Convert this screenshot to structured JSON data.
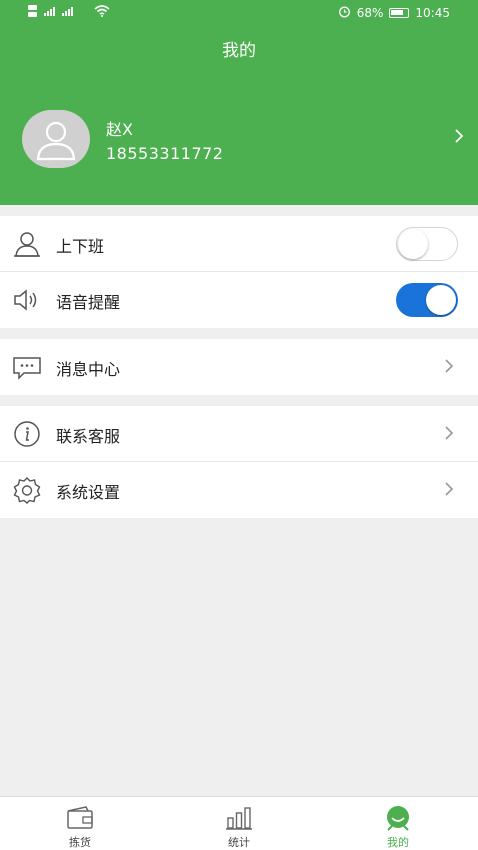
{
  "status_bar": {
    "battery": "68%",
    "time": "10:45"
  },
  "header": {
    "title": "我的"
  },
  "profile": {
    "name": "赵X",
    "phone": "18553311772"
  },
  "settings": {
    "shift": {
      "label": "上下班",
      "enabled": false
    },
    "voice": {
      "label": "语音提醒",
      "enabled": true
    }
  },
  "menu": {
    "messages": "消息中心",
    "contact": "联系客服",
    "system": "系统设置"
  },
  "tabbar": {
    "picking": "拣货",
    "stats": "统计",
    "mine": "我的",
    "active": "mine"
  },
  "colors": {
    "brand": "#4caf50",
    "toggle_on": "#1a73d9"
  }
}
